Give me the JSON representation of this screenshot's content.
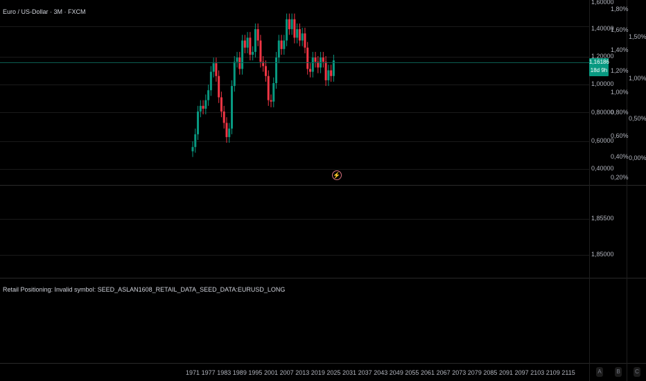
{
  "chart": {
    "title": "Euro / US-Dollar · 3M · FXCM",
    "current_price": "1,16186",
    "countdown": "18d 9h",
    "accent_up": "#089981",
    "accent_down": "#f23645"
  },
  "price_axis": {
    "ticks": [
      "1,60000",
      "1,40000",
      "1,20000",
      "1,00000",
      "0,80000",
      "0,60000",
      "0,40000"
    ]
  },
  "pct_axis_1": {
    "ticks": [
      "1,80%",
      "1,60%",
      "1,40%",
      "1,20%",
      "1,00%",
      "0,80%",
      "0,60%",
      "0,40%",
      "0,20%"
    ]
  },
  "pct_axis_2": {
    "ticks": [
      "1,50%",
      "1,00%",
      "0,50%",
      "0,00%"
    ]
  },
  "pane2_axis": {
    "ticks": [
      "1,85500",
      "1,85000"
    ]
  },
  "indicator": {
    "label": "Retail Positioning: Invalid symbol: SEED_ASLAN1608_RETAIL_DATA_SEED_DATA:EURUSD_LONG"
  },
  "time_axis": {
    "ticks": [
      "1971",
      "1977",
      "1983",
      "1989",
      "1995",
      "2001",
      "2007",
      "2013",
      "2019",
      "2025",
      "2031",
      "2037",
      "2043",
      "2049",
      "2055",
      "2061",
      "2067",
      "2073",
      "2079",
      "2085",
      "2091",
      "2097",
      "2103",
      "2109",
      "2115"
    ]
  },
  "scale_buttons": [
    "A",
    "B",
    "C"
  ],
  "chart_data": {
    "type": "candlestick",
    "title": "Euro / US-Dollar · 3M · FXCM",
    "x": [
      1971,
      1972,
      1973,
      1974,
      1975,
      1976,
      1977,
      1978,
      1979,
      1980,
      1981,
      1982,
      1983,
      1984,
      1985,
      1986,
      1987,
      1988,
      1989,
      1990,
      1991,
      1992,
      1993,
      1994,
      1995,
      1996,
      1997,
      1998,
      1999,
      2000,
      2001,
      2002,
      2003,
      2004,
      2005,
      2006,
      2007,
      2008,
      2009,
      2010,
      2011,
      2012,
      2013,
      2014,
      2015,
      2016,
      2017,
      2018,
      2019,
      2020,
      2021,
      2022,
      2023,
      2024,
      2025
    ],
    "values": [
      0.55,
      0.64,
      0.8,
      0.84,
      0.82,
      0.88,
      0.95,
      1.08,
      1.14,
      1.05,
      0.9,
      0.8,
      0.72,
      0.62,
      0.68,
      0.98,
      1.15,
      1.18,
      1.1,
      1.3,
      1.25,
      1.32,
      1.2,
      1.22,
      1.38,
      1.3,
      1.15,
      1.12,
      1.05,
      0.88,
      0.87,
      1.0,
      1.18,
      1.3,
      1.24,
      1.3,
      1.45,
      1.38,
      1.45,
      1.32,
      1.38,
      1.3,
      1.35,
      1.25,
      1.1,
      1.08,
      1.18,
      1.15,
      1.11,
      1.18,
      1.15,
      1.02,
      1.09,
      1.05,
      1.16
    ],
    "ylim": [
      0.3,
      1.95
    ],
    "current": 1.16186
  }
}
